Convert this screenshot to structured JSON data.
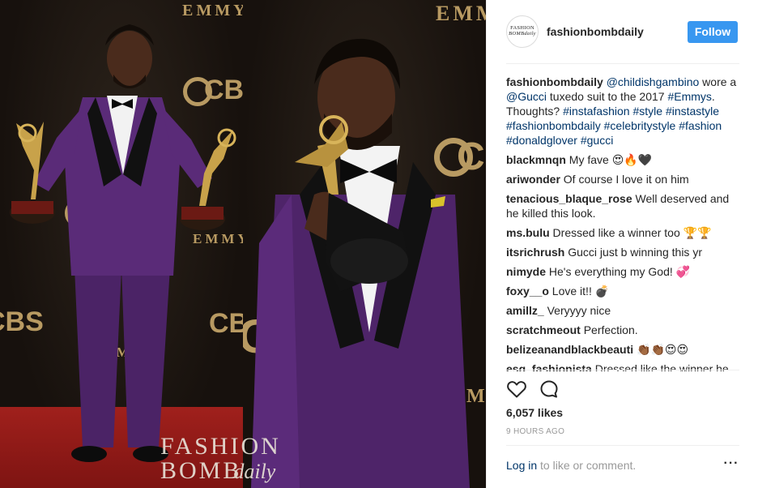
{
  "post": {
    "username": "fashionbombdaily",
    "avatar_line1": "FASHION",
    "avatar_line2": "BOMBdaily",
    "follow_label": "Follow",
    "watermark": {
      "line1": "FASHION",
      "line2": "BOMB",
      "line3": "daily"
    },
    "backdrop": {
      "emmy": "EMMY",
      "cbs": "CBS"
    },
    "caption": {
      "username": "fashionbombdaily",
      "segments": [
        {
          "type": "tag",
          "text": "@childishgambino"
        },
        {
          "type": "text",
          "text": " wore a "
        },
        {
          "type": "tag",
          "text": "@Gucci"
        },
        {
          "type": "text",
          "text": " tuxedo suit to the 2017 "
        },
        {
          "type": "tag",
          "text": "#Emmys"
        },
        {
          "type": "text",
          "text": ". Thoughts? "
        },
        {
          "type": "tag",
          "text": "#instafashion"
        },
        {
          "type": "text",
          "text": " "
        },
        {
          "type": "tag",
          "text": "#style"
        },
        {
          "type": "text",
          "text": " "
        },
        {
          "type": "tag",
          "text": "#instastyle"
        },
        {
          "type": "text",
          "text": " "
        },
        {
          "type": "tag",
          "text": "#fashionbombdaily"
        },
        {
          "type": "text",
          "text": " "
        },
        {
          "type": "tag",
          "text": "#celebritystyle"
        },
        {
          "type": "text",
          "text": " "
        },
        {
          "type": "tag",
          "text": "#fashion"
        },
        {
          "type": "text",
          "text": " "
        },
        {
          "type": "tag",
          "text": "#donaldglover"
        },
        {
          "type": "text",
          "text": " "
        },
        {
          "type": "tag",
          "text": "#gucci"
        }
      ]
    },
    "comments": [
      {
        "user": "blackmnqn",
        "text": "My fave",
        "emoji": "😍🔥🖤"
      },
      {
        "user": "ariwonder",
        "text": "Of course I love it on him",
        "emoji": ""
      },
      {
        "user": "tenacious_blaque_rose",
        "text": "Well deserved and he killed this look.",
        "emoji": ""
      },
      {
        "user": "ms.bulu",
        "text": "Dressed like a winner too",
        "emoji": "🏆🏆"
      },
      {
        "user": "itsrichrush",
        "text": "Gucci just b winning this yr",
        "emoji": ""
      },
      {
        "user": "nimyde",
        "text": "He's everything my God!",
        "emoji": "💞"
      },
      {
        "user": "foxy__o",
        "text": "Love it!!",
        "emoji": "💣"
      },
      {
        "user": "amillz_",
        "text": "Veryyyy nice",
        "emoji": ""
      },
      {
        "user": "scratchmeout",
        "text": "Perfection.",
        "emoji": ""
      },
      {
        "user": "belizeanandblackbeauti",
        "text": "",
        "emoji": "👏🏾👏🏾😍😍"
      },
      {
        "user": "esq_fashionista",
        "text": "Dressed like the winner he",
        "emoji": ""
      }
    ],
    "actions": {
      "like_icon": "heart-outline-icon",
      "comment_icon": "comment-bubble-icon"
    },
    "likes": "6,057 likes",
    "timestamp": "9 HOURS AGO",
    "login_link": "Log in",
    "login_suffix": " to like or comment.",
    "more_icon": "more-options-icon",
    "colors": {
      "follow_bg": "#3897f0",
      "tag": "#003569",
      "muted": "#999999",
      "text": "#262626"
    }
  }
}
